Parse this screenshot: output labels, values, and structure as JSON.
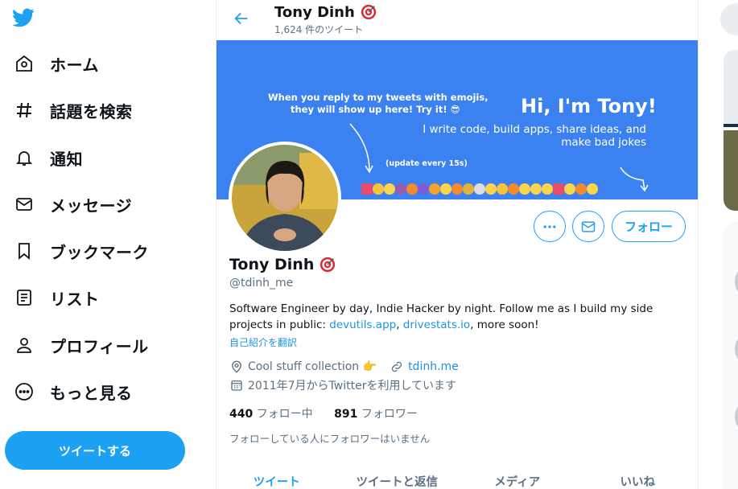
{
  "colors": {
    "brand": "#1da1f2",
    "link": "#1b95e0",
    "banner": "#3b82f0",
    "muted": "#5b7083"
  },
  "sidebar": {
    "logo_icon": "twitter-bird-icon",
    "items": [
      {
        "label": "ホーム",
        "icon": "home-icon"
      },
      {
        "label": "話題を検索",
        "icon": "hashtag-icon"
      },
      {
        "label": "通知",
        "icon": "bell-icon"
      },
      {
        "label": "メッセージ",
        "icon": "envelope-icon"
      },
      {
        "label": "ブックマーク",
        "icon": "bookmark-icon"
      },
      {
        "label": "リスト",
        "icon": "list-icon"
      },
      {
        "label": "プロフィール",
        "icon": "person-icon"
      },
      {
        "label": "もっと見る",
        "icon": "more-circle-icon"
      }
    ],
    "tweet_button": "ツイートする"
  },
  "header": {
    "name": "Tony Dinh",
    "tweet_count": "1,624 件のツイート"
  },
  "banner": {
    "left_line1": "When you reply to my tweets with emojis,",
    "left_line2": "they will show up here! Try it! 😎",
    "hi": "Hi, I'm Tony!",
    "sub_line1": "I write code, build apps, share ideas, and",
    "sub_line2": "make bad jokes",
    "update_note": "(update every 15s)"
  },
  "profile": {
    "name": "Tony Dinh",
    "handle": "@tdinh_me",
    "bio_text": "Software Engineer by day, Indie Hacker by night. Follow me as I build my side projects in public: ",
    "bio_link1": "devutils.app",
    "bio_sep": ", ",
    "bio_link2": "drivestats.io",
    "bio_end": ", more soon!",
    "translate": "自己紹介を翻訳",
    "location": "Cool stuff collection 👉",
    "website": "tdinh.me",
    "joined": "2011年7月からTwitterを利用しています",
    "following_count": "440",
    "following_label": "フォロー中",
    "followers_count": "891",
    "followers_label": "フォロワー",
    "no_followers_note": "フォローしている人にフォロワーはいません"
  },
  "actions": {
    "more": "more-icon",
    "message": "envelope-icon",
    "follow": "フォロー"
  },
  "tabs": [
    {
      "label": "ツイート",
      "active": true
    },
    {
      "label": "ツイートと返信",
      "active": false
    },
    {
      "label": "メディア",
      "active": false
    },
    {
      "label": "いいね",
      "active": false
    }
  ]
}
